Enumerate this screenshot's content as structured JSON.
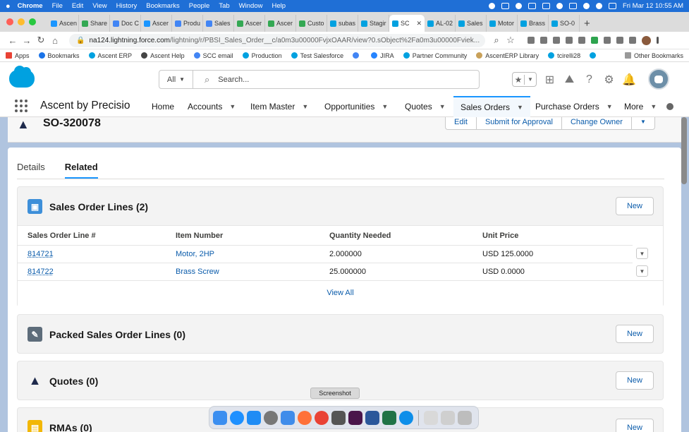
{
  "menubar": {
    "items": [
      "Chrome",
      "File",
      "Edit",
      "View",
      "History",
      "Bookmarks",
      "People",
      "Tab",
      "Window",
      "Help"
    ],
    "clock": "Fri Mar 12  10:55 AM"
  },
  "browser": {
    "tabs": [
      {
        "label": "Ascen",
        "color": "#1b96ff"
      },
      {
        "label": "Share",
        "color": "#34a853"
      },
      {
        "label": "Doc C",
        "color": "#4285f4"
      },
      {
        "label": "Ascer",
        "color": "#1b96ff"
      },
      {
        "label": "Produ",
        "color": "#4285f4"
      },
      {
        "label": "Sales",
        "color": "#4285f4"
      },
      {
        "label": "Ascer",
        "color": "#34a853"
      },
      {
        "label": "Ascer",
        "color": "#34a853"
      },
      {
        "label": "Custo",
        "color": "#34a853"
      },
      {
        "label": "subas",
        "color": "#00a1e0"
      },
      {
        "label": "Stagir",
        "color": "#00a1e0"
      },
      {
        "label": "SC",
        "color": "#00a1e0",
        "active": true
      },
      {
        "label": "AL-02",
        "color": "#00a1e0"
      },
      {
        "label": "Sales",
        "color": "#00a1e0"
      },
      {
        "label": "Motor",
        "color": "#00a1e0"
      },
      {
        "label": "Brass",
        "color": "#00a1e0"
      },
      {
        "label": "SO-0",
        "color": "#00a1e0"
      }
    ],
    "url_main": "na124.lightning.force.com",
    "url_rest": "/lightning/r/PBSI_Sales_Order__c/a0m3u00000FvjxOAAR/view?0.sObject%2Fa0m3u00000Fviek...",
    "bookmarks": [
      "Apps",
      "Bookmarks",
      "Ascent ERP",
      "Ascent Help",
      "SCC email",
      "Production",
      "Test Salesforce",
      "",
      "JIRA",
      "Partner Community",
      "AscentERP Library",
      "tcirelli28",
      ""
    ],
    "other_bookmarks": "Other Bookmarks"
  },
  "sf": {
    "search_scope": "All",
    "search_placeholder": "Search...",
    "app_name": "Ascent by Precisio",
    "nav": [
      {
        "label": "Home"
      },
      {
        "label": "Accounts"
      },
      {
        "label": "Item Master"
      },
      {
        "label": "Opportunities"
      },
      {
        "label": "Quotes"
      },
      {
        "label": "Sales Orders"
      },
      {
        "label": "Purchase Orders"
      },
      {
        "label": "More"
      }
    ],
    "record_title": "SO-320078",
    "actions": [
      "Edit",
      "Submit for Approval",
      "Change Owner"
    ],
    "tabs": [
      "Details",
      "Related"
    ],
    "sales_order_lines": {
      "title": "Sales Order Lines (2)",
      "new": "New",
      "columns": [
        "Sales Order Line #",
        "Item Number",
        "Quantity Needed",
        "Unit Price"
      ],
      "rows": [
        {
          "line": "814721",
          "item": "Motor, 2HP",
          "qty": "2.000000",
          "price": "USD 125.0000"
        },
        {
          "line": "814722",
          "item": "Brass Screw",
          "qty": "25.000000",
          "price": "USD 0.0000"
        }
      ],
      "view_all": "View All"
    },
    "packed_lines": {
      "title": "Packed Sales Order Lines (0)",
      "new": "New"
    },
    "quotes": {
      "title": "Quotes (0)",
      "new": "New"
    },
    "rmas": {
      "title": "RMAs (0)",
      "new": "New"
    }
  },
  "dock": {
    "tooltip": "Screenshot"
  }
}
